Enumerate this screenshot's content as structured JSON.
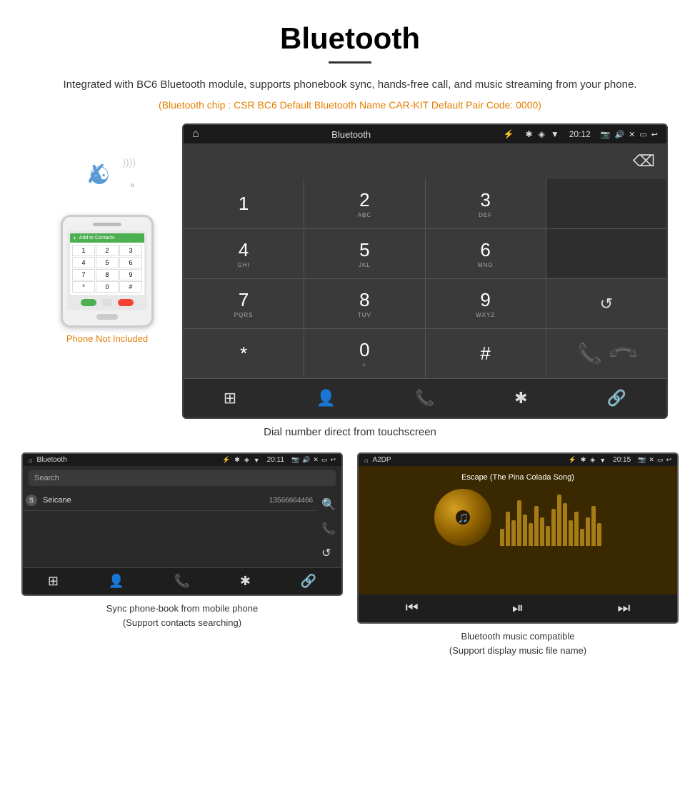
{
  "page": {
    "title": "Bluetooth",
    "subtitle": "Integrated with BC6 Bluetooth module, supports phonebook sync, hands-free call, and music streaming from your phone.",
    "specs": "(Bluetooth chip : CSR BC6    Default Bluetooth Name CAR-KIT    Default Pair Code: 0000)",
    "main_caption": "Dial number direct from touchscreen",
    "phone_not_included": "Phone Not Included",
    "bottom_left_caption_line1": "Sync phone-book from mobile phone",
    "bottom_left_caption_line2": "(Support contacts searching)",
    "bottom_right_caption_line1": "Bluetooth music compatible",
    "bottom_right_caption_line2": "(Support display music file name)"
  },
  "large_screen": {
    "statusbar": {
      "home": "⌂",
      "title": "Bluetooth",
      "usb_icon": "⚡",
      "bt_icon": "✱",
      "location_icon": "◈",
      "signal_icon": "▼",
      "time": "20:12",
      "camera_icon": "📷",
      "volume_icon": "🔊",
      "close_icon": "✕",
      "window_icon": "▭",
      "back_icon": "↩"
    },
    "dialpad": {
      "keys": [
        {
          "num": "1",
          "sub": ""
        },
        {
          "num": "2",
          "sub": "ABC"
        },
        {
          "num": "3",
          "sub": "DEF"
        },
        {
          "num": "4",
          "sub": "GHI"
        },
        {
          "num": "5",
          "sub": "JKL"
        },
        {
          "num": "6",
          "sub": "MNO"
        },
        {
          "num": "7",
          "sub": "PQRS"
        },
        {
          "num": "8",
          "sub": "TUV"
        },
        {
          "num": "9",
          "sub": "WXYZ"
        },
        {
          "num": "*",
          "sub": ""
        },
        {
          "num": "0",
          "sub": "+"
        },
        {
          "num": "#",
          "sub": ""
        }
      ]
    },
    "bottom_icons": [
      "⊞",
      "👤",
      "📞",
      "✱",
      "🔗"
    ]
  },
  "phonebook_screen": {
    "statusbar_title": "Bluetooth",
    "time": "20:11",
    "search_placeholder": "Search",
    "contact": {
      "letter": "S",
      "name": "Seicane",
      "phone": "13566664466"
    }
  },
  "music_screen": {
    "statusbar_title": "A2DP",
    "time": "20:15",
    "song_title": "Escape (The Pina Colada Song)"
  }
}
